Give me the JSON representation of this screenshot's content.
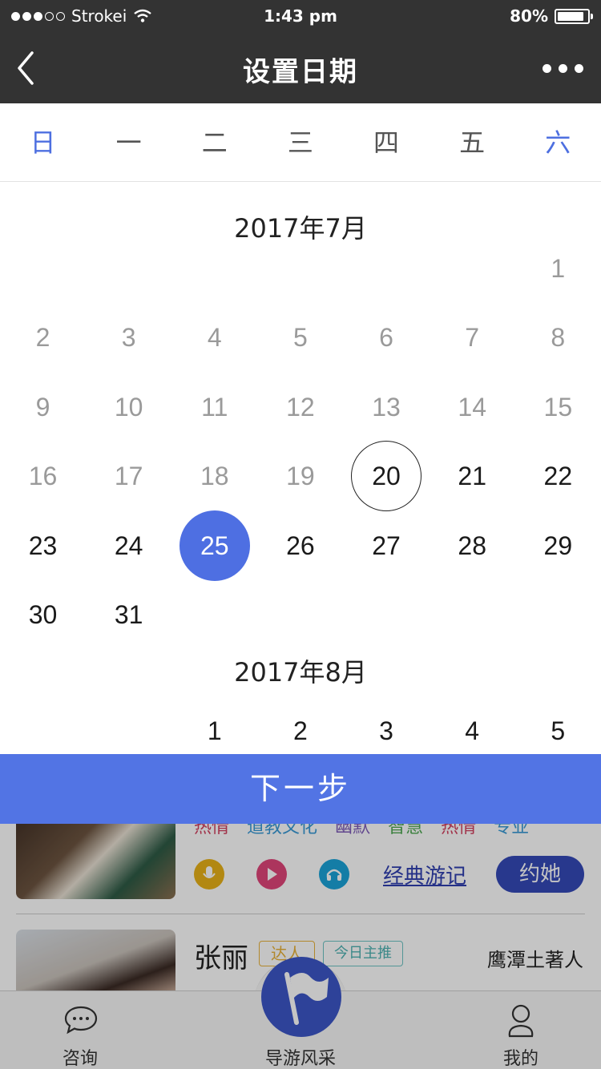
{
  "status_bar": {
    "carrier": "Strokei",
    "time": "1:43 pm",
    "battery": "80%",
    "battery_level": 0.8
  },
  "nav": {
    "title": "设置日期",
    "back_icon": "chevron-left-icon",
    "more_icon": "more-dots-icon"
  },
  "weekdays": [
    "日",
    "一",
    "二",
    "三",
    "四",
    "五",
    "六"
  ],
  "calendar": {
    "months": [
      {
        "title": "2017年7月"
      },
      {
        "title": "2017年8月"
      }
    ],
    "july_days": [
      "1",
      "2",
      "3",
      "4",
      "5",
      "6",
      "7",
      "8",
      "9",
      "10",
      "11",
      "12",
      "13",
      "14",
      "15",
      "16",
      "17",
      "18",
      "19",
      "20",
      "21",
      "22",
      "23",
      "24",
      "25",
      "26",
      "27",
      "28",
      "29",
      "30",
      "31"
    ],
    "august_days": [
      "1",
      "2",
      "3",
      "4",
      "5"
    ],
    "today": "20",
    "selected": "25"
  },
  "next_button": "下一步",
  "background_list": {
    "tags": [
      "热情",
      "道教文化",
      "幽默",
      "智慧",
      "热情",
      "专业"
    ],
    "travel_notes": "经典游记",
    "book_button": "约她",
    "guide_name": "张丽",
    "badge_1": "达人",
    "badge_2": "今日主推",
    "hometown": "鹰潭土著人"
  },
  "tab_bar": {
    "tabs": [
      {
        "label": "咨询",
        "icon": "chat-bubble-icon"
      },
      {
        "label": "导游风采",
        "icon": "flag-icon"
      },
      {
        "label": "我的",
        "icon": "user-icon"
      }
    ]
  }
}
